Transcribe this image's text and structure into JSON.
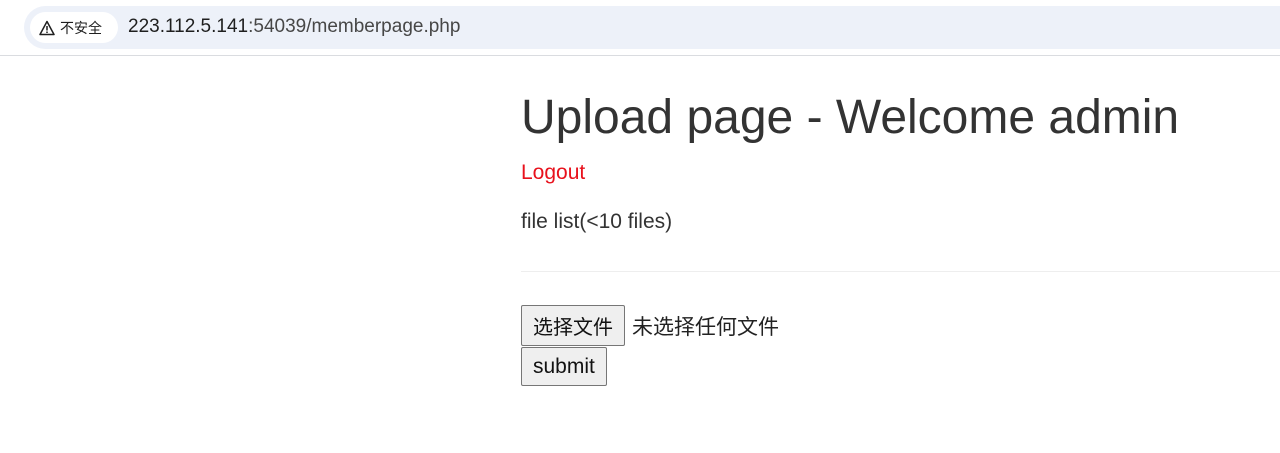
{
  "browser": {
    "security_label": "不安全",
    "url_host": "223.112.5.141",
    "url_rest": ":54039/memberpage.php",
    "icons": {
      "security": "warning-triangle-icon"
    }
  },
  "page": {
    "title": "Upload page - Welcome admin",
    "logout_label": "Logout",
    "file_list_label": "file list(<10 files)",
    "choose_file_button": "选择文件",
    "no_file_selected": "未选择任何文件",
    "submit_button": "submit"
  },
  "colors": {
    "link": "#e8111c",
    "text": "#333333",
    "omnibox_bg": "#edf1f9"
  }
}
